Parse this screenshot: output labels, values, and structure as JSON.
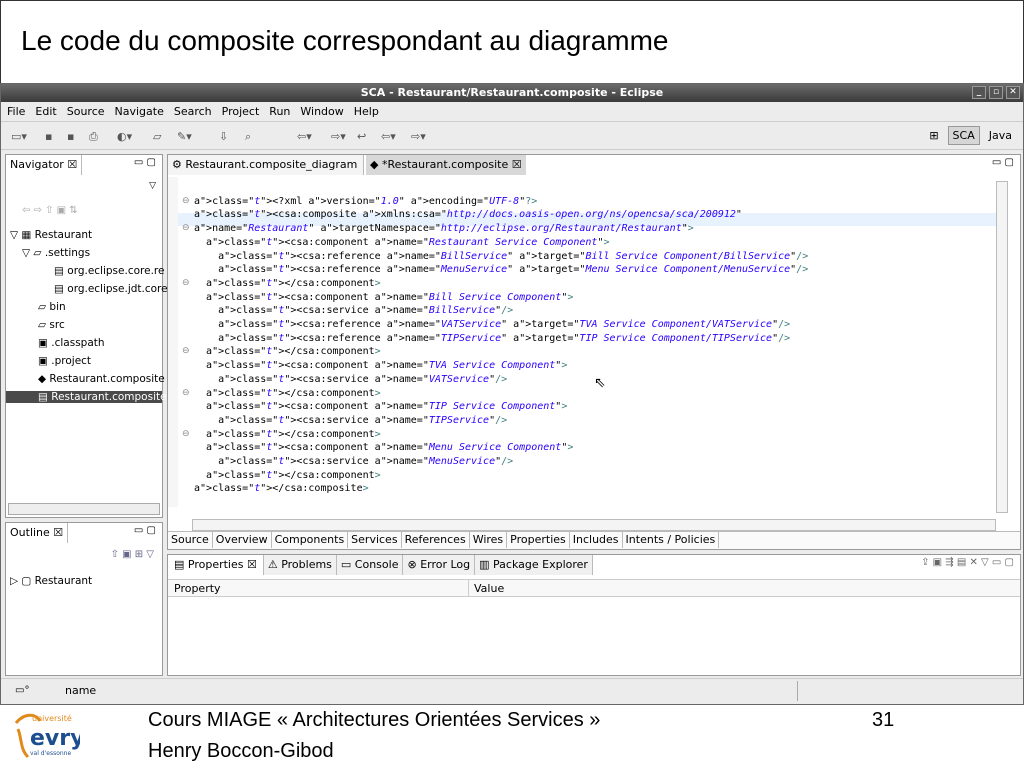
{
  "slide": {
    "title": "Le code du composite correspondant au diagramme"
  },
  "window": {
    "title": "SCA - Restaurant/Restaurant.composite - Eclipse",
    "buttons": [
      "_",
      "▫",
      "✕"
    ]
  },
  "menu": [
    "File",
    "Edit",
    "Source",
    "Navigate",
    "Search",
    "Project",
    "Run",
    "Window",
    "Help"
  ],
  "perspectives": {
    "sca": "SCA",
    "java": "Java"
  },
  "navigator": {
    "title": "Navigator ☒",
    "items": [
      "Restaurant",
      ".settings",
      "org.eclipse.core.re",
      "org.eclipse.jdt.core",
      "bin",
      "src",
      ".classpath",
      ".project",
      "Restaurant.composite",
      "Restaurant.composite"
    ]
  },
  "editor": {
    "tabs": [
      "Restaurant.composite_diagram",
      "*Restaurant.composite ☒"
    ],
    "bottom_tabs": [
      "Source",
      "Overview",
      "Components",
      "Services",
      "References",
      "Wires",
      "Properties",
      "Includes",
      "Intents / Policies"
    ]
  },
  "code": [
    "<?xml version=\"1.0\" encoding=\"UTF-8\"?>",
    "<csa:composite xmlns:csa=\"http://docs.oasis-open.org/ns/opencsa/sca/200912\"",
    "name=\"Restaurant\" targetNamespace=\"http://eclipse.org/Restaurant/Restaurant\">",
    "  <csa:component name=\"Restaurant Service Component\">",
    "    <csa:reference name=\"BillService\" target=\"Bill Service Component/BillService\"/>",
    "    <csa:reference name=\"MenuService\" target=\"Menu Service Component/MenuService\"/>",
    "  </csa:component>",
    "  <csa:component name=\"Bill Service Component\">",
    "    <csa:service name=\"BillService\"/>",
    "    <csa:reference name=\"VATService\" target=\"TVA Service Component/VATService\"/>",
    "    <csa:reference name=\"TIPService\" target=\"TIP Service Component/TIPService\"/>",
    "  </csa:component>",
    "  <csa:component name=\"TVA Service Component\">",
    "    <csa:service name=\"VATService\"/>",
    "  </csa:component>",
    "  <csa:component name=\"TIP Service Component\">",
    "    <csa:service name=\"TIPService\"/>",
    "  </csa:component>",
    "  <csa:component name=\"Menu Service Component\">",
    "    <csa:service name=\"MenuService\"/>",
    "  </csa:component>",
    "</csa:composite>"
  ],
  "outline": {
    "title": "Outline ☒",
    "item": "Restaurant"
  },
  "bottom": {
    "tabs": [
      "Properties ☒",
      "Problems",
      "Console",
      "Error Log",
      "Package Explorer"
    ],
    "col_property": "Property",
    "col_value": "Value"
  },
  "status": {
    "text": "name"
  },
  "footer": {
    "course": "Cours MIAGE   « Architectures Orientées Services »",
    "author": "Henry Boccon-Gibod",
    "page": "31",
    "logo_top": "université",
    "logo_main": "evry",
    "logo_sub": "val d'essonne"
  }
}
